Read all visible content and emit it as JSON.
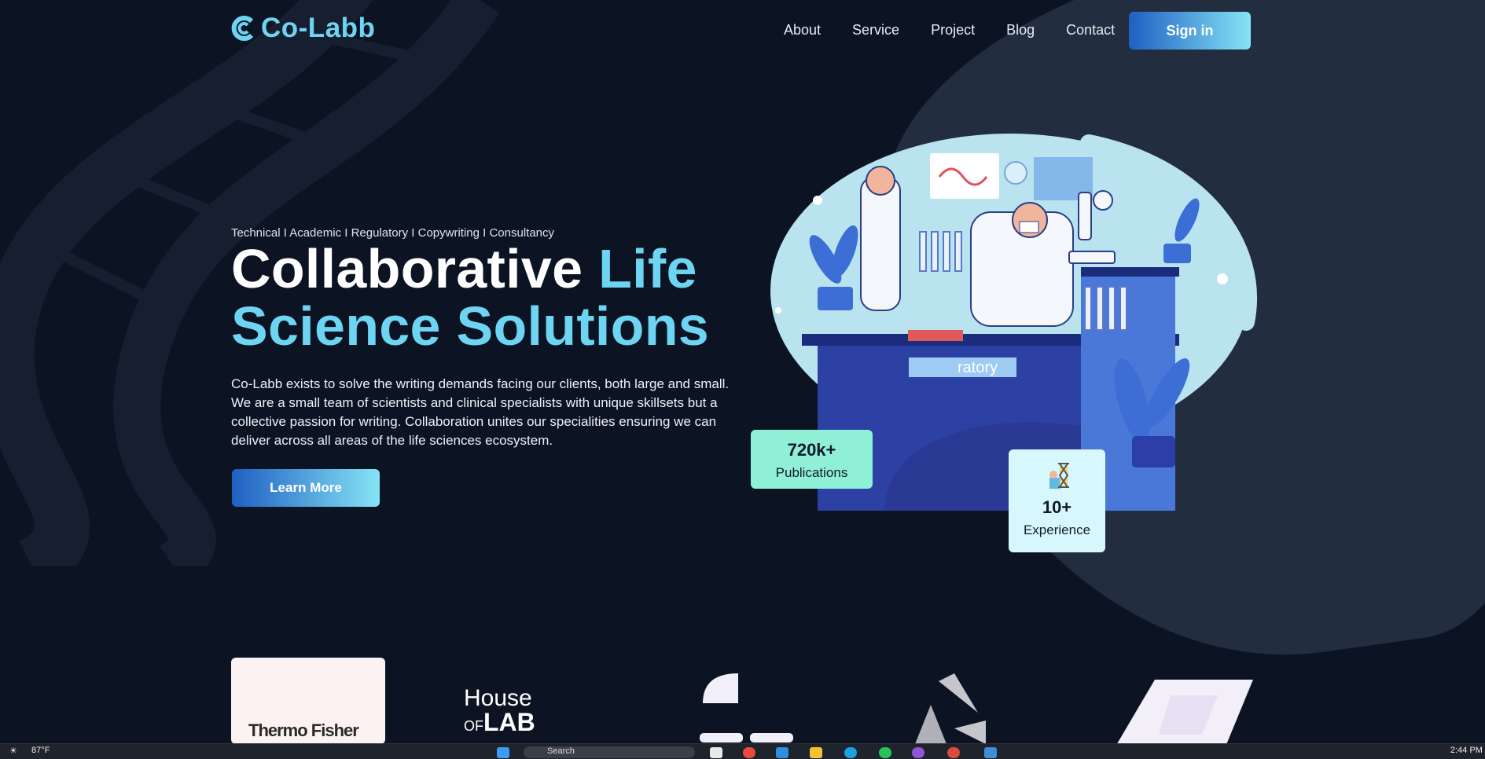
{
  "brand": {
    "name": "Co-Labb",
    "color": "#6dd5f2"
  },
  "nav": {
    "items": [
      "About",
      "Service",
      "Project",
      "Blog",
      "Contact"
    ],
    "signin_label": "Sign in"
  },
  "hero": {
    "tagline": "Technical I Academic I Regulatory I Copywriting I Consultancy",
    "headline_white": "Collaborative ",
    "headline_cyan1": "Life",
    "headline_cyan2": "Science Solutions",
    "description": "Co-Labb exists to solve the writing demands facing our clients, both large and small. We are a small team of scientists and clinical specialists with unique skillsets but a collective passion for writing. Collaboration unites our specialities ensuring we can deliver across all areas of the life sciences ecosystem.",
    "cta_label": "Learn More",
    "lab_sign": "ratory"
  },
  "stats": [
    {
      "value": "720k+",
      "label": "Publications"
    },
    {
      "value": "10+",
      "label": "Experience"
    }
  ],
  "partners": {
    "thermo": "Thermo Fisher",
    "house_line1": "House",
    "house_of": "OF",
    "house_lab": "LAB"
  },
  "taskbar": {
    "weather": "87°F",
    "time": "2:44 PM",
    "search": "Search"
  }
}
